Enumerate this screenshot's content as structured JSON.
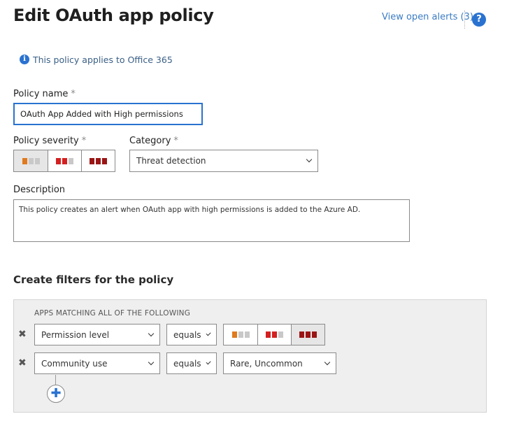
{
  "header": {
    "title": "Edit OAuth app policy",
    "alerts_link": "View open alerts (3)",
    "help_label": "?"
  },
  "info": {
    "text": "This policy applies to Office 365"
  },
  "form": {
    "policy_name": {
      "label": "Policy name",
      "required_mark": "*",
      "value": "OAuth App Added with High permissions"
    },
    "severity": {
      "label": "Policy severity",
      "required_mark": "*",
      "selected": "low"
    },
    "category": {
      "label": "Category",
      "required_mark": "*",
      "value": "Threat detection"
    },
    "description": {
      "label": "Description",
      "value": "This policy creates an alert when OAuth app with high permissions is added to the Azure AD."
    }
  },
  "filters": {
    "title": "Create filters for the policy",
    "heading": "APPS MATCHING ALL OF THE FOLLOWING",
    "remove_glyph": "✖",
    "add_glyph": "✚",
    "rows": [
      {
        "field": "Permission level",
        "operator": "equals",
        "value_type": "severity",
        "selected": "high"
      },
      {
        "field": "Community use",
        "operator": "equals",
        "value": "Rare, Uncommon"
      }
    ]
  },
  "colors": {
    "accent": "#2a72d0",
    "severity_low": "#e07a1f",
    "severity_medium": "#d42020",
    "severity_high": "#9a1515",
    "bar_inactive": "#c8c8c8"
  }
}
